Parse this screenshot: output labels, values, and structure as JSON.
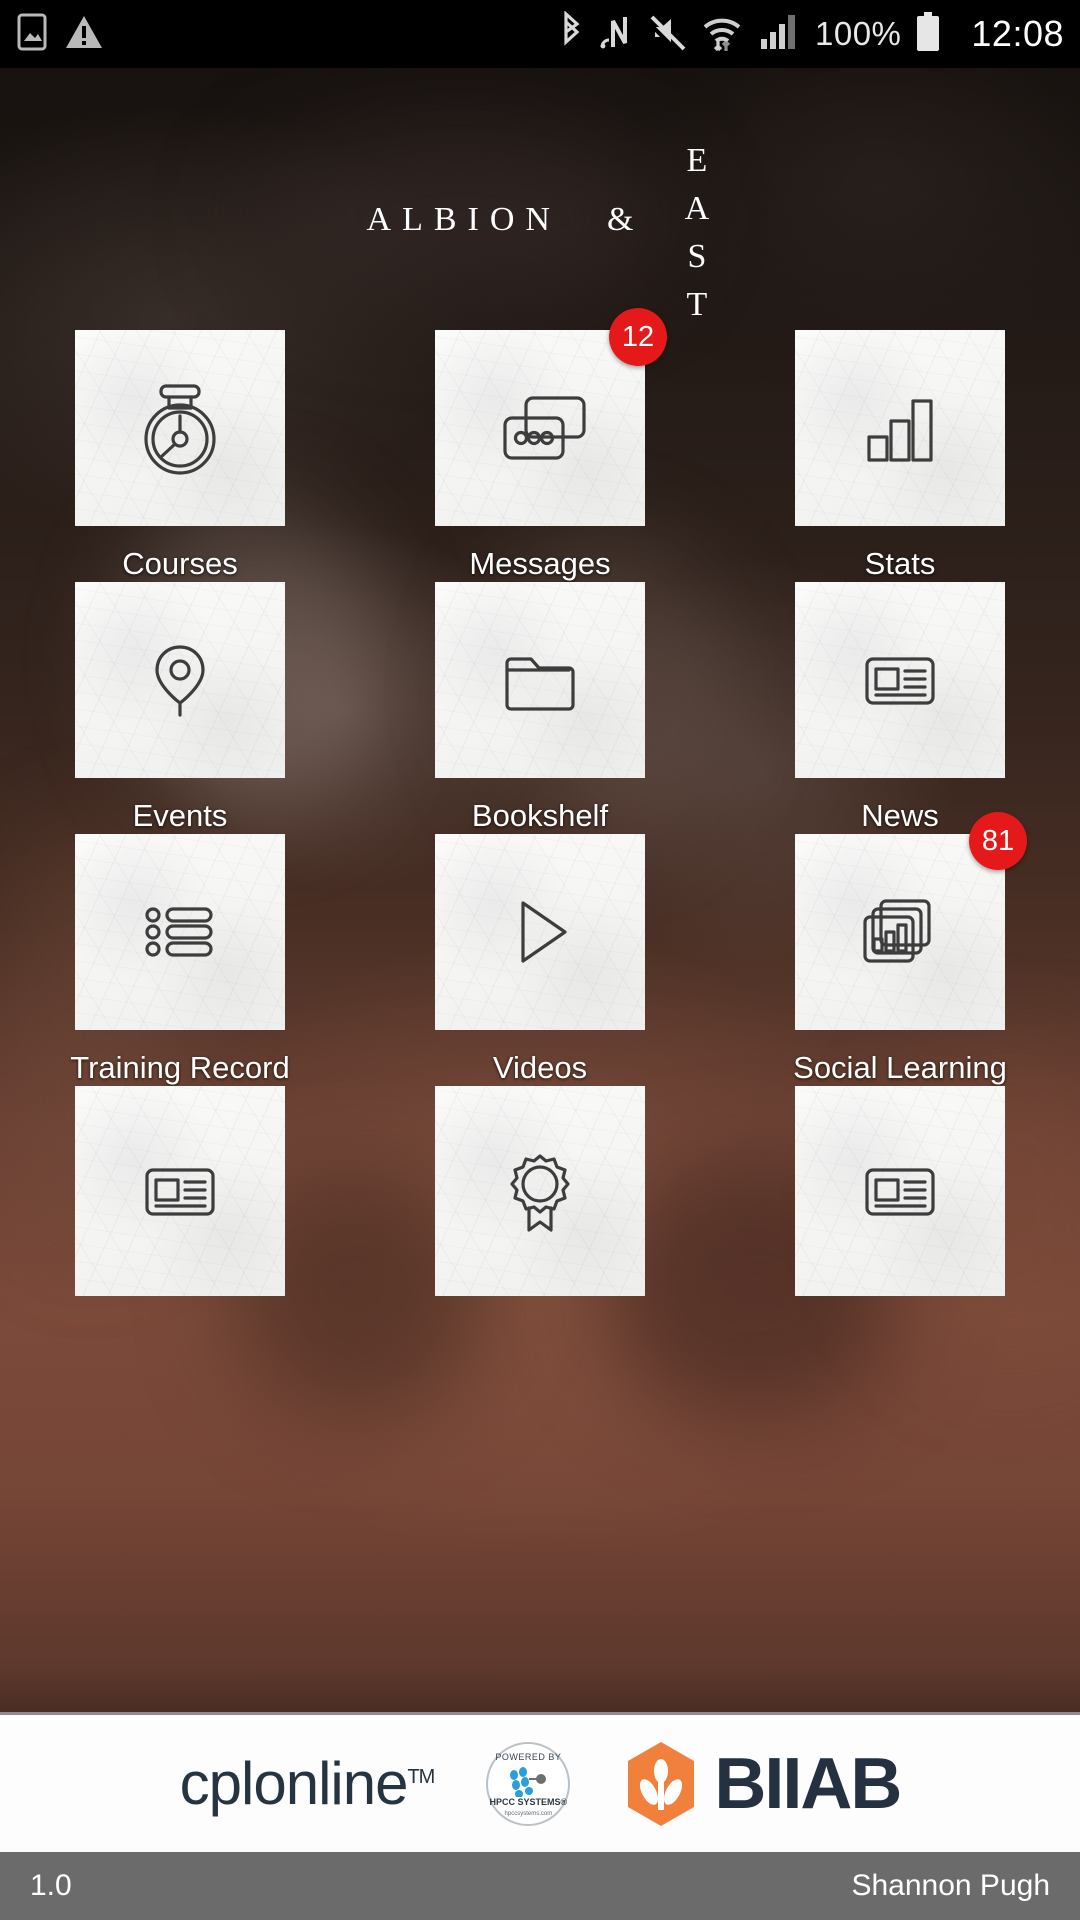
{
  "statusbar": {
    "icons": [
      "image-icon",
      "warning-triangle-icon",
      "bluetooth-icon",
      "nfc-icon",
      "mute-icon",
      "wifi-icon",
      "signal-icon"
    ],
    "battery_percent": "100%",
    "battery_icon": "battery-full-icon",
    "clock": "12:08"
  },
  "logo": {
    "word1": "ALBION",
    "ampersand": "&",
    "word2": "EAST"
  },
  "grid": {
    "items": [
      {
        "label": "Courses",
        "icon": "stopwatch-icon",
        "badge": ""
      },
      {
        "label": "Messages",
        "icon": "chat-bubbles-icon",
        "badge": "12"
      },
      {
        "label": "Stats",
        "icon": "bar-chart-icon",
        "badge": ""
      },
      {
        "label": "Events",
        "icon": "map-pin-icon",
        "badge": ""
      },
      {
        "label": "Bookshelf",
        "icon": "folder-icon",
        "badge": ""
      },
      {
        "label": "News",
        "icon": "news-article-icon",
        "badge": ""
      },
      {
        "label": "Training Record",
        "icon": "checklist-icon",
        "badge": ""
      },
      {
        "label": "Videos",
        "icon": "play-triangle-icon",
        "badge": ""
      },
      {
        "label": "Social Learning",
        "icon": "stacked-chart-icon",
        "badge": "81"
      },
      {
        "label": "",
        "icon": "news-article-icon",
        "badge": ""
      },
      {
        "label": "",
        "icon": "award-rosette-icon",
        "badge": ""
      },
      {
        "label": "",
        "icon": "news-article-icon",
        "badge": ""
      }
    ]
  },
  "sponsors": {
    "cpl_name": "cplonline",
    "cpl_tm": "TM",
    "hpcc_top": "POWERED BY",
    "hpcc_name": "HPCC SYSTEMS®",
    "hpcc_url": "hpccsystems.com",
    "biiab_name": "BIIAB"
  },
  "footer": {
    "version": "1.0",
    "user": "Shannon Pugh"
  },
  "colors": {
    "badge_red": "#e51919",
    "footer_gray": "#6b6b6b",
    "biiab_orange": "#f0803c",
    "biiab_navy": "#253140"
  }
}
